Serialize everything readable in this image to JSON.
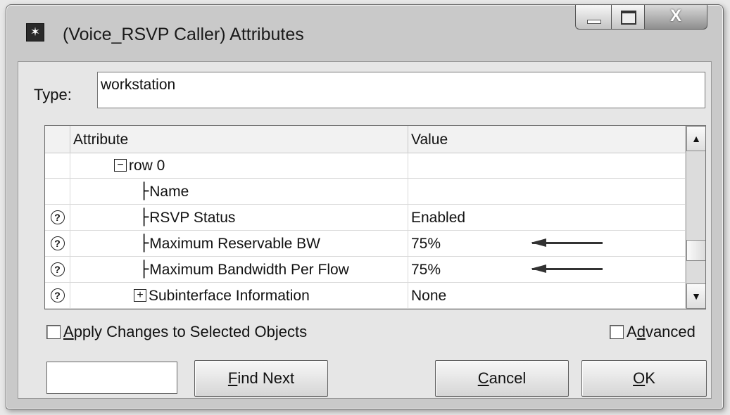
{
  "window": {
    "title": "(Voice_RSVP Caller) Attributes",
    "close_glyph": "X"
  },
  "type_field": {
    "label": "Type:",
    "value": "workstation"
  },
  "table": {
    "headers": {
      "attribute": "Attribute",
      "value": "Value"
    },
    "rows": [
      {
        "help": "",
        "tree": "−",
        "attribute": "row 0",
        "value": ""
      },
      {
        "help": "",
        "tree": "",
        "attribute": "Name",
        "value": ""
      },
      {
        "help": "?",
        "tree": "",
        "attribute": "RSVP Status",
        "value": "Enabled"
      },
      {
        "help": "?",
        "tree": "",
        "attribute": "Maximum Reservable BW",
        "value": "75%"
      },
      {
        "help": "?",
        "tree": "",
        "attribute": "Maximum Bandwidth Per Flow",
        "value": "75%"
      },
      {
        "help": "?",
        "tree": "+",
        "attribute": "Subinterface Information",
        "value": "None"
      }
    ],
    "scroll_up": "▲",
    "scroll_down": "▼",
    "scroll_position": 0.8
  },
  "apply_changes": {
    "access_key": "A",
    "rest": "pply Changes to Selected Objects"
  },
  "advanced": {
    "before": "A",
    "access_key": "d",
    "rest": "vanced"
  },
  "buttons": {
    "find_next": {
      "access_key": "F",
      "rest": "ind Next"
    },
    "cancel": {
      "access_key": "C",
      "rest": "ancel"
    },
    "ok": {
      "access_key": "O",
      "rest": "K"
    }
  },
  "colors": {
    "window_bg": "#c9c9c9",
    "client_bg": "#e6e6e6",
    "arrow": "#333333"
  }
}
